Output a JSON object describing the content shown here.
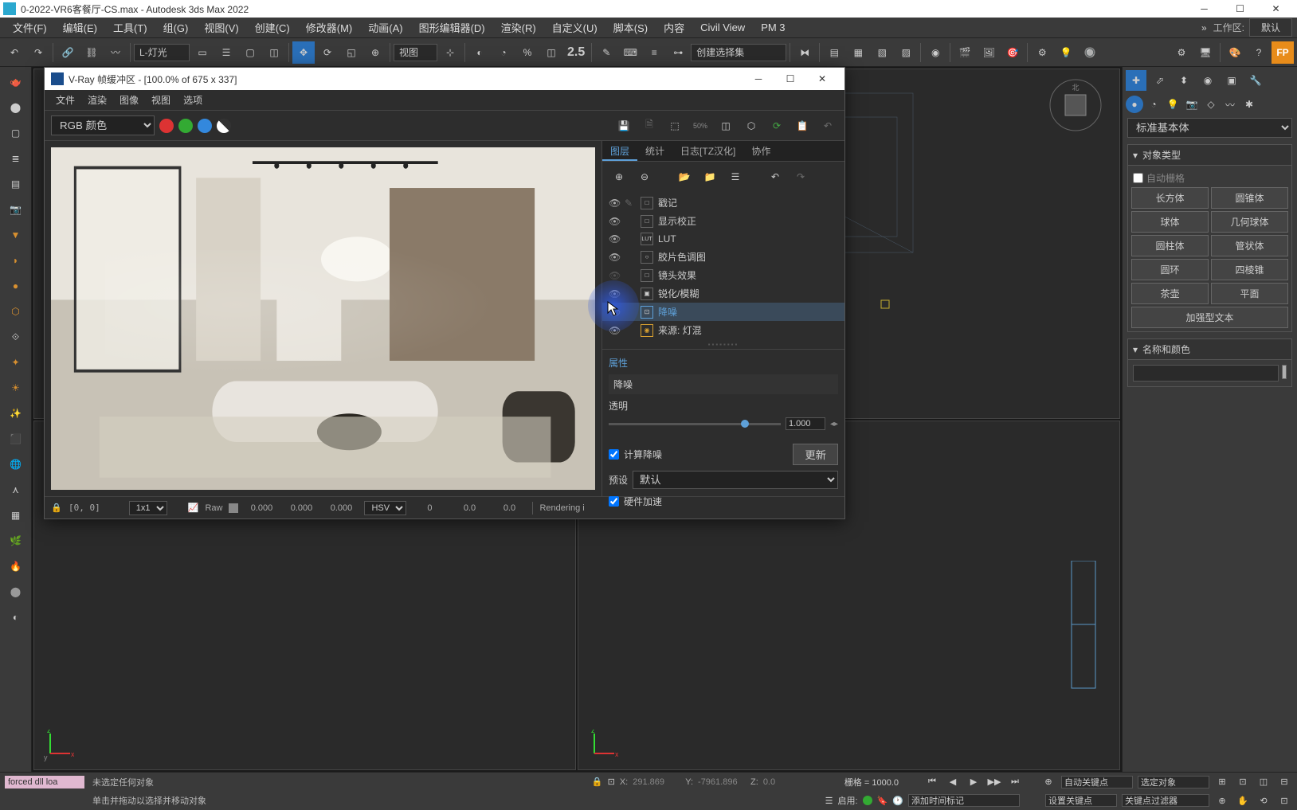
{
  "title": "0-2022-VR6客餐厅-CS.max - Autodesk 3ds Max 2022",
  "menus": [
    "文件(F)",
    "编辑(E)",
    "工具(T)",
    "组(G)",
    "视图(V)",
    "创建(C)",
    "修改器(M)",
    "动画(A)",
    "图形编辑器(D)",
    "渲染(R)",
    "自定义(U)",
    "脚本(S)",
    "内容",
    "Civil View",
    "PM 3"
  ],
  "workspace_label": "工作区:",
  "workspace_value": "默认",
  "toolbar": {
    "filter": "L-灯光",
    "view_label": "视图",
    "scale": "2.5",
    "select_set": "创建选择集"
  },
  "vfb": {
    "title": "V-Ray 帧缓冲区 - [100.0% of 675 x 337]",
    "menus": [
      "文件",
      "渲染",
      "图像",
      "视图",
      "选项"
    ],
    "channel": "RGB 颜色",
    "tabs": [
      "图层",
      "统计",
      "日志[TZ汉化]",
      "协作"
    ],
    "layers": [
      {
        "name": "戳记",
        "icon": "□"
      },
      {
        "name": "显示校正",
        "icon": "□"
      },
      {
        "name": "LUT",
        "icon": "LUT"
      },
      {
        "name": "胶片色调图",
        "icon": "○"
      },
      {
        "name": "镜头效果",
        "icon": "□"
      },
      {
        "name": "锐化/模糊",
        "icon": "▣"
      },
      {
        "name": "降噪",
        "icon": "⊡",
        "selected": true
      },
      {
        "name": "来源: 灯混",
        "icon": "◉"
      }
    ],
    "props_title": "属性",
    "prop_denoise": "降噪",
    "prop_opacity": "透明",
    "opacity_val": "1.000",
    "calc_denoise": "计算降噪",
    "update_btn": "更新",
    "preset_label": "预设",
    "preset_value": "默认",
    "hw_accel": "硬件加速",
    "status": {
      "coord": "[0, 0]",
      "zoom": "1x1",
      "raw": "Raw",
      "r": "0.000",
      "g": "0.000",
      "b": "0.000",
      "mode": "HSV",
      "h": "0",
      "s": "0.0",
      "v": "0.0",
      "rendering": "Rendering i"
    }
  },
  "cmd": {
    "category": "标准基本体",
    "obj_type": "对象类型",
    "auto_grid": "自动栅格",
    "prims": [
      "长方体",
      "圆锥体",
      "球体",
      "几何球体",
      "圆柱体",
      "管状体",
      "圆环",
      "四棱锥",
      "茶壶",
      "平面",
      "加强型文本"
    ],
    "name_color": "名称和颜色"
  },
  "status": {
    "no_sel": "未选定任何对象",
    "hint": "单击并拖动以选择并移动对象",
    "forced": "forced dll loa",
    "x": "291.869",
    "y": "-7961.896",
    "z": "0.0",
    "grid": "栅格 = 1000.0",
    "auto_key": "自动关键点",
    "sel_obj": "选定对象",
    "enable": "启用:",
    "add_time": "添加时间标记",
    "set_key": "设置关键点",
    "key_filter": "关键点过滤器"
  }
}
